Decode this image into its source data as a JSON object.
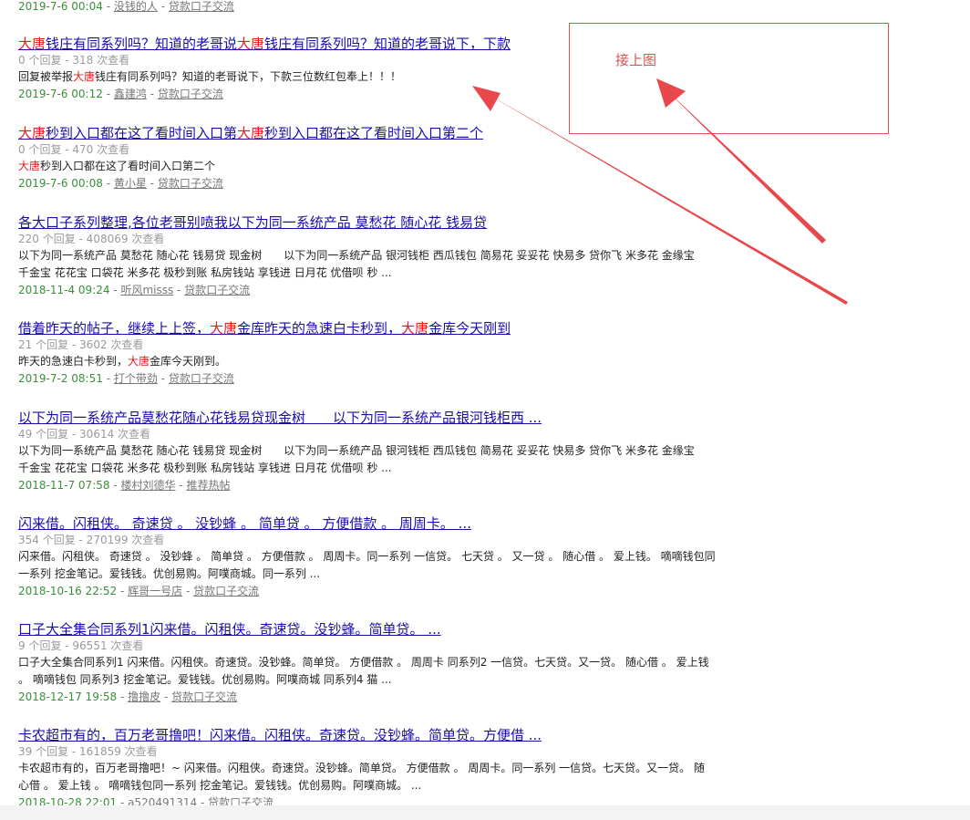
{
  "top_meta": {
    "date": "2019-7-6 00:04",
    "author": "没钱的人",
    "forum": "贷款口子交流"
  },
  "note": {
    "text": "接上图",
    "color": "#d9534f"
  },
  "colors": {
    "link": "#1a0dab",
    "highlight": "#e0201b",
    "date": "#3a8f3a",
    "stats": "#9a9a9a",
    "arrow": "#e8474b"
  },
  "results": [
    {
      "title": [
        {
          "hl": true,
          "t": "大唐"
        },
        {
          "t": "钱庄有同系列吗？知道的老哥说"
        },
        {
          "hl": true,
          "t": "大唐"
        },
        {
          "t": "钱庄有同系列吗？知道的老哥说下，下款"
        }
      ],
      "stats": "0 个回复 - 318 次查看",
      "snippet": [
        [
          {
            "t": "回复被举报"
          },
          {
            "hl": true,
            "t": "大唐"
          },
          {
            "t": "钱庄有同系列吗？知道的老哥说下，下款三位数红包奉上！！！"
          }
        ]
      ],
      "date": "2019-7-6 00:12",
      "author": "鑫建鸿",
      "author_link": true,
      "forum": "贷款口子交流"
    },
    {
      "title": [
        {
          "hl": true,
          "t": "大唐"
        },
        {
          "t": "秒到入口都在这了看时间入口第"
        },
        {
          "hl": true,
          "t": "大唐"
        },
        {
          "t": "秒到入口都在这了看时间入口第二个"
        }
      ],
      "stats": "0 个回复 - 470 次查看",
      "snippet": [
        [
          {
            "hl": true,
            "t": "大唐"
          },
          {
            "t": "秒到入口都在这了看时间入口第二个"
          }
        ]
      ],
      "date": "2019-7-6 00:08",
      "author": "黄小星",
      "author_link": true,
      "forum": "贷款口子交流"
    },
    {
      "title": [
        {
          "t": "各大口子系列整理,各位老哥别喷我以下为同一系统产品 莫愁花 随心花 钱易贷"
        }
      ],
      "stats": "220 个回复 - 408069 次查看",
      "snippet": [
        [
          {
            "t": "以下为同一系统产品 莫愁花 随心花 钱易贷 现金树　　以下为同一系统产品 银河钱柜 西瓜钱包 简易花 妥妥花 快易多 贷你飞 米多花 金缘宝"
          }
        ],
        [
          {
            "t": "千金宝 花花宝 口袋花 米多花 极秒到账 私房钱站 享钱进 日月花 优借呗 秒 ..."
          }
        ]
      ],
      "date": "2018-11-4 09:24",
      "author": "听风misss",
      "author_link": true,
      "forum": "贷款口子交流"
    },
    {
      "title": [
        {
          "t": "借着昨天的帖子，继续上上签，"
        },
        {
          "hl": true,
          "t": "大唐"
        },
        {
          "t": "金库昨天的急速白卡秒到，"
        },
        {
          "hl": true,
          "t": "大唐"
        },
        {
          "t": "金库今天刚到"
        }
      ],
      "stats": "21 个回复 - 3602 次查看",
      "snippet": [
        [
          {
            "t": "昨天的急速白卡秒到，"
          },
          {
            "hl": true,
            "t": "大唐"
          },
          {
            "t": "金库今天刚到。"
          }
        ]
      ],
      "date": "2019-7-2 08:51",
      "author": "打个带劲",
      "author_link": true,
      "forum": "贷款口子交流"
    },
    {
      "title": [
        {
          "t": "以下为同一系统产品莫愁花随心花钱易贷现金树　　以下为同一系统产品银河钱柜西 ..."
        }
      ],
      "stats": "49 个回复 - 30614 次查看",
      "snippet": [
        [
          {
            "t": "以下为同一系统产品 莫愁花 随心花 钱易贷 现金树　　以下为同一系统产品 银河钱柜 西瓜钱包 简易花 妥妥花 快易多 贷你飞 米多花 金缘宝"
          }
        ],
        [
          {
            "t": "千金宝 花花宝 口袋花 米多花 极秒到账 私房钱站 享钱进 日月花 优借呗 秒 ..."
          }
        ]
      ],
      "date": "2018-11-7 07:58",
      "author": "楼村刘德华",
      "author_link": true,
      "forum": "推荐热帖"
    },
    {
      "title": [
        {
          "t": "闪来借。闪租侠。 奇速贷 。 没钞蜂 。 简单贷 。 方便借款 。 周周卡。 ..."
        }
      ],
      "stats": "354 个回复 - 270199 次查看",
      "snippet": [
        [
          {
            "t": "闪来借。闪租侠。 奇速贷 。 没钞蜂 。 简单贷 。 方便借款 。 周周卡。同一系列 一信贷。 七天贷 。 又一贷 。 随心借 。 爱上钱。 嘀嘀钱包同"
          }
        ],
        [
          {
            "t": "一系列 挖金笔记。爱钱钱。优创易购。阿噗商城。同一系列 ..."
          }
        ]
      ],
      "date": "2018-10-16 22:52",
      "author": "辉哥一号店",
      "author_link": true,
      "forum": "贷款口子交流"
    },
    {
      "title": [
        {
          "t": "口子大全集合同系列1闪来借。闪租侠。奇速贷。没钞蜂。简单贷。 ..."
        }
      ],
      "stats": "9 个回复 - 96551 次查看",
      "snippet": [
        [
          {
            "t": "口子大全集合同系列1 闪来借。闪租侠。奇速贷。没钞蜂。简单贷。 方便借款 。 周周卡 同系列2 一信贷。七天贷。又一贷。 随心借 。 爱上钱"
          }
        ],
        [
          {
            "t": "。 嘀嘀钱包 同系列3 挖金笔记。爱钱钱。优创易购。阿噗商城 同系列4 猫 ..."
          }
        ]
      ],
      "date": "2018-12-17 19:58",
      "author": "撸撸皮",
      "author_link": true,
      "forum": "贷款口子交流"
    },
    {
      "title": [
        {
          "t": "卡农超市有的，百万老哥撸吧！闪来借。闪租侠。奇速贷。没钞蜂。简单贷。方便借 ..."
        }
      ],
      "stats": "39 个回复 - 161859 次查看",
      "snippet": [
        [
          {
            "t": "卡农超市有的，百万老哥撸吧！~ 闪来借。闪租侠。奇速贷。没钞蜂。简单贷。 方便借款 。 周周卡。同一系列 一信贷。七天贷。又一贷。 随"
          }
        ],
        [
          {
            "t": "心借 。 爱上钱 。 嘀嘀钱包同一系列 挖金笔记。爱钱钱。优创易购。阿噗商城。 ..."
          }
        ]
      ],
      "date": "2018-10-28 22:01",
      "author": "a520491314",
      "author_link": false,
      "forum": "贷款口子交流"
    }
  ]
}
